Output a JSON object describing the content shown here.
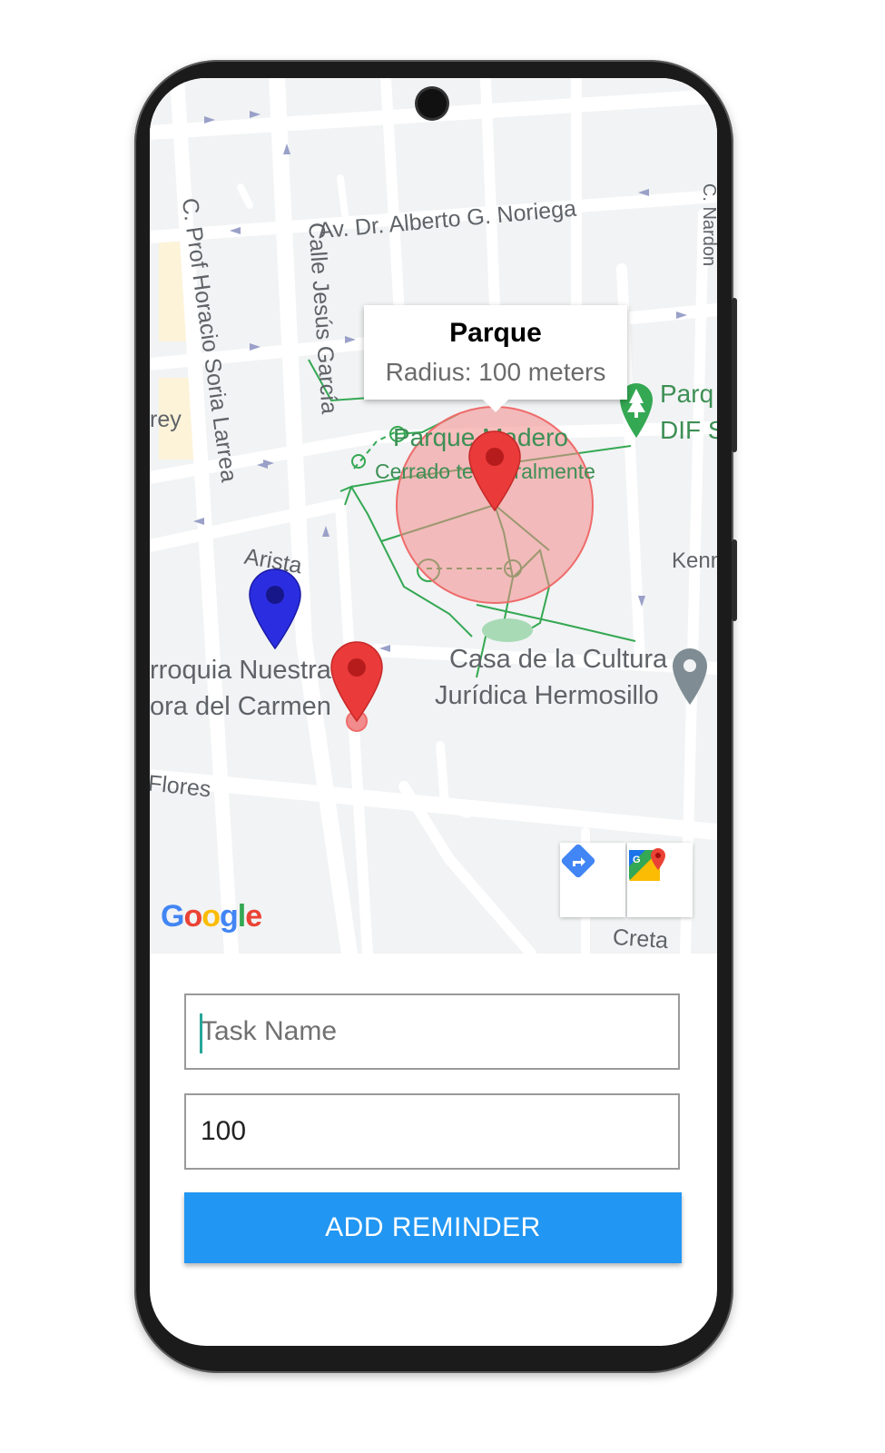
{
  "map": {
    "street_labels": [
      "Av. Dr. Alberto G. Noriega",
      "C. Prof Horacio Soria Larrea",
      "Calle Jesús García",
      "Arista",
      "Flores",
      "Creta",
      "Kenn",
      "rey",
      "C. Nardon"
    ],
    "place_labels": {
      "parque_madero": "Parque Madero",
      "parque_madero_status": "Cerrado temporalmente",
      "casa_cultura_line1": "Casa de la Cultura",
      "casa_cultura_line2": "Jurídica Hermosillo",
      "parroquia_line1": "rroquia Nuestra",
      "parroquia_line2": "ora del Carmen",
      "parque_dif_line1": "Parq",
      "parque_dif_line2": "DIF S"
    },
    "info_window": {
      "title": "Parque",
      "subtitle": "Radius: 100 meters"
    },
    "attribution": "Google",
    "controls": [
      "directions-icon",
      "google-maps-icon"
    ]
  },
  "form": {
    "task_name": {
      "placeholder": "Task Name",
      "value": ""
    },
    "radius": {
      "placeholder": "",
      "value": "100"
    },
    "submit_label": "ADD REMINDER"
  },
  "colors": {
    "button": "#2196f3",
    "geofence_fill": "#f28b8b",
    "marker_red": "#ea3a3a",
    "marker_blue": "#2b2ee0",
    "park_path": "#34a853"
  }
}
